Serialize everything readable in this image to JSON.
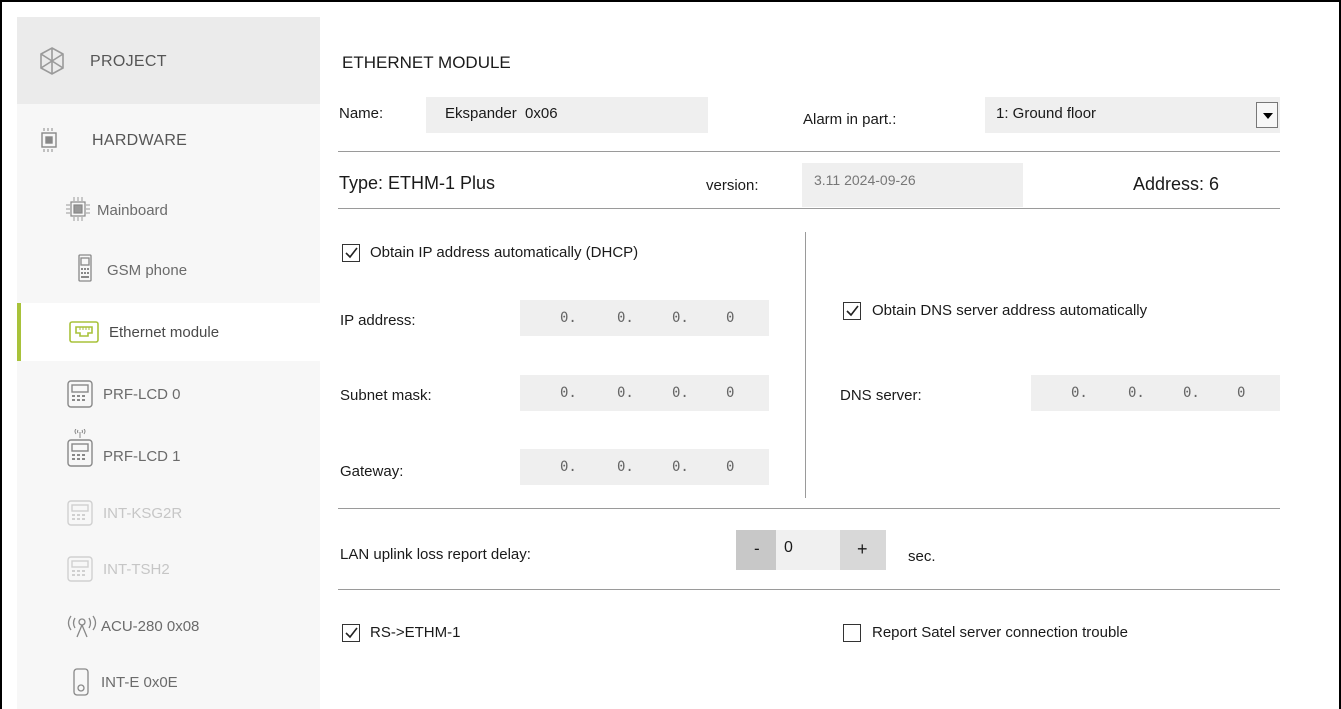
{
  "sidebar": {
    "project": "PROJECT",
    "hardware": "HARDWARE",
    "items": [
      {
        "label": "Mainboard",
        "icon": "mainboard-icon"
      },
      {
        "label": "GSM phone",
        "icon": "phone-icon"
      },
      {
        "label": "Ethernet module",
        "icon": "ethernet-icon"
      },
      {
        "label": "PRF-LCD 0",
        "icon": "keypad-icon"
      },
      {
        "label": "PRF-LCD 1",
        "icon": "wireless-keypad-icon"
      },
      {
        "label": "INT-KSG2R",
        "icon": "keypad-icon"
      },
      {
        "label": "INT-TSH2",
        "icon": "keypad-icon"
      },
      {
        "label": "ACU-280 0x08",
        "icon": "antenna-icon"
      },
      {
        "label": "INT-E 0x0E",
        "icon": "module-icon"
      }
    ]
  },
  "main": {
    "title": "ETHERNET MODULE",
    "name_label": "Name:",
    "name_value": "Ekspander  0x06",
    "alarm_label": "Alarm in part.:",
    "alarm_value": "1: Ground floor",
    "type_label": "Type: ETHM-1 Plus",
    "version_label": "version:",
    "version_value": "3.11 2024-09-26",
    "address_label": "Address: 6",
    "dhcp_label": "Obtain IP address automatically (DHCP)",
    "ip_label": "IP address:",
    "subnet_label": "Subnet mask:",
    "gateway_label": "Gateway:",
    "ip_octets": [
      "0.",
      "0.",
      "0.",
      "0"
    ],
    "subnet_octets": [
      "0.",
      "0.",
      "0.",
      "0"
    ],
    "gateway_octets": [
      "0.",
      "0.",
      "0.",
      "0"
    ],
    "dns_auto_label": "Obtain DNS server address automatically",
    "dns_label": "DNS server:",
    "dns_octets": [
      "0.",
      "0.",
      "0.",
      "0"
    ],
    "lan_label": "LAN uplink loss report delay:",
    "lan_minus": "-",
    "lan_value": "0",
    "lan_plus": "+",
    "lan_unit": "sec.",
    "rs_label": "RS->ETHM-1",
    "satel_label": "Report Satel server connection trouble"
  },
  "colors": {
    "accent": "#a8c23a",
    "sidebar_bg": "#f7f7f7",
    "field_bg": "#efefef"
  }
}
